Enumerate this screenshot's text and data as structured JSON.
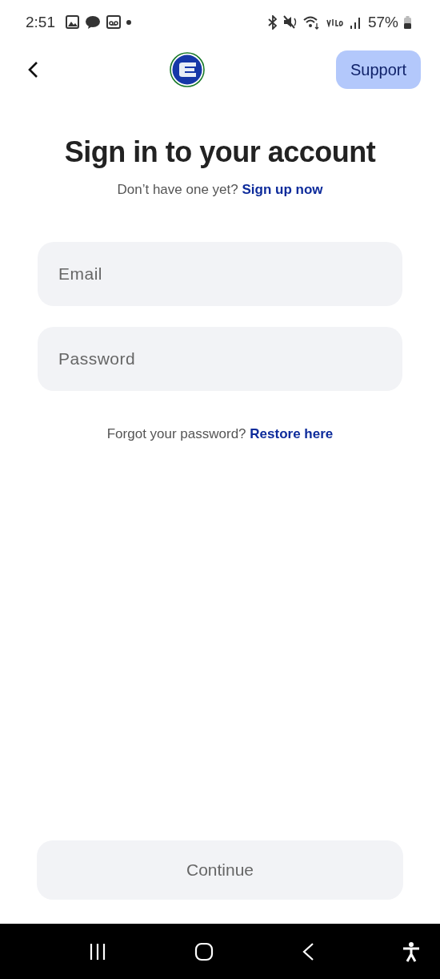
{
  "status_bar": {
    "time": "2:51",
    "battery": "57%"
  },
  "header": {
    "support_button": "Support"
  },
  "title": "Sign in to your account",
  "signup": {
    "prompt": "Don’t have one yet?",
    "link": "Sign up now"
  },
  "fields": [
    {
      "placeholder": "Email"
    },
    {
      "placeholder": "Password"
    }
  ],
  "forgot": {
    "prompt": "Forgot your password?",
    "link": "Restore here"
  },
  "continue_button": {
    "label": "Continue",
    "disabled": true
  }
}
